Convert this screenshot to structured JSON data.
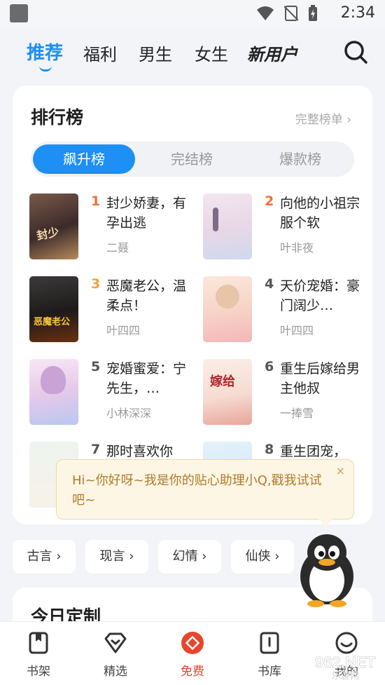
{
  "status_bar": {
    "time": "2:34"
  },
  "top_tabs": [
    {
      "label": "推荐",
      "active": true
    },
    {
      "label": "福利"
    },
    {
      "label": "男生"
    },
    {
      "label": "女生"
    },
    {
      "label": "新用户"
    }
  ],
  "ranking": {
    "title": "排行榜",
    "more_label": "完整榜单 ›",
    "segments": [
      "飙升榜",
      "完结榜",
      "爆款榜"
    ],
    "books": [
      {
        "rank": "1",
        "title": "封少娇妻，有孕出逃",
        "author": "二聂"
      },
      {
        "rank": "2",
        "title": "向他的小祖宗服个软",
        "author": "叶非夜"
      },
      {
        "rank": "3",
        "title": "恶魔老公，温柔点！",
        "author": "叶四四"
      },
      {
        "rank": "4",
        "title": "天价宠婚：豪门阔少…",
        "author": "叶四四"
      },
      {
        "rank": "5",
        "title": "宠婚蜜爱：宁先生，…",
        "author": "小林深深"
      },
      {
        "rank": "6",
        "title": "重生后嫁给男主他叔",
        "author": "一捧雪"
      },
      {
        "rank": "7",
        "title": "那时喜欢你",
        "author": ""
      },
      {
        "rank": "8",
        "title": "重生团宠，",
        "author": ""
      }
    ]
  },
  "tooltip": {
    "text": "Hi~你好呀~我是你的贴心助理小Q,戳我试试吧~",
    "close": "×"
  },
  "categories": [
    "古言 ›",
    "现言 ›",
    "幻情 ›",
    "仙侠 ›"
  ],
  "today": {
    "title": "今日定制"
  },
  "bottom_nav": [
    {
      "label": "书架"
    },
    {
      "label": "精选"
    },
    {
      "label": "免费",
      "active": true
    },
    {
      "label": "书库"
    },
    {
      "label": "我的"
    }
  ],
  "watermark": {
    "text": "962.NET",
    "sub": "乐游网"
  },
  "colors": {
    "accent": "#1d8ff5",
    "rank_top": "#f0703a",
    "rank_third": "#f2a23a",
    "rank_other": "#555555",
    "free_red": "#e8452c"
  }
}
